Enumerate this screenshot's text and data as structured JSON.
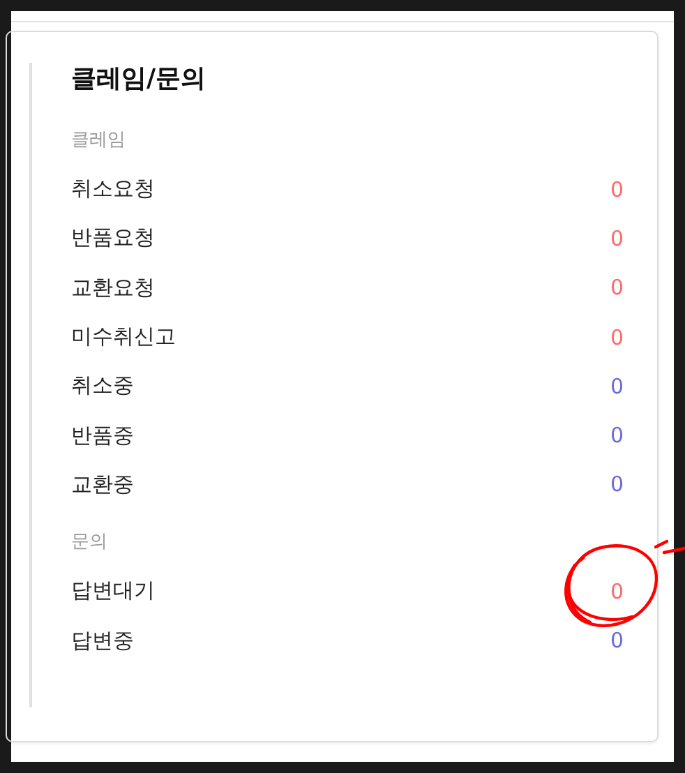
{
  "title": "클레임/문의",
  "sections": [
    {
      "label": "클레임",
      "items": [
        {
          "name": "취소요청",
          "count": "0",
          "color": "#ff6b6b"
        },
        {
          "name": "반품요청",
          "count": "0",
          "color": "#ff6b6b"
        },
        {
          "name": "교환요청",
          "count": "0",
          "color": "#ff6b6b"
        },
        {
          "name": "미수취신고",
          "count": "0",
          "color": "#ff6b6b"
        },
        {
          "name": "취소중",
          "count": "0",
          "color": "#6c6cdc"
        },
        {
          "name": "반품중",
          "count": "0",
          "color": "#6c6cdc"
        },
        {
          "name": "교환중",
          "count": "0",
          "color": "#6c6cdc"
        }
      ]
    },
    {
      "label": "문의",
      "items": [
        {
          "name": "답변대기",
          "count": "0",
          "color": "#ff6b6b"
        },
        {
          "name": "답변중",
          "count": "0",
          "color": "#6c6cdc"
        }
      ]
    }
  ]
}
